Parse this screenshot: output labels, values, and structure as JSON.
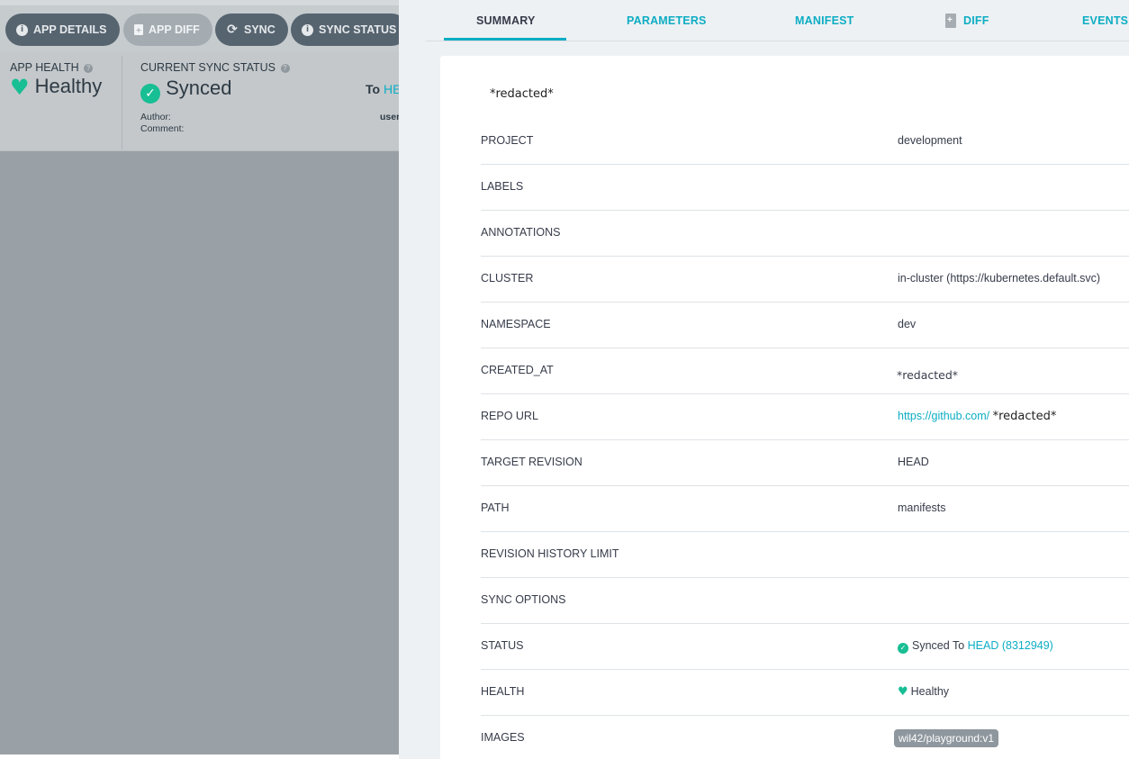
{
  "toolbar": {
    "app_details": "APP DETAILS",
    "app_diff": "APP DIFF",
    "sync": "SYNC",
    "sync_status": "SYNC STATUS"
  },
  "status": {
    "app_health_label": "APP HEALTH",
    "app_health_value": "Healthy",
    "sync_status_label": "CURRENT SYNC STATUS",
    "sync_status_value": "Synced",
    "to_prefix": "To",
    "to_revision": "HE",
    "author_label": "Author:",
    "comment_label": "Comment:",
    "author_value": "user"
  },
  "tabs": {
    "summary": "SUMMARY",
    "parameters": "PARAMETERS",
    "manifest": "MANIFEST",
    "diff": "DIFF",
    "events": "EVENTS"
  },
  "summary": {
    "title": "*redacted*",
    "project_label": "PROJECT",
    "project_value": "development",
    "labels_label": "LABELS",
    "annotations_label": "ANNOTATIONS",
    "cluster_label": "CLUSTER",
    "cluster_value": "in-cluster (https://kubernetes.default.svc)",
    "namespace_label": "NAMESPACE",
    "namespace_value": "dev",
    "created_at_label": "CREATED_AT",
    "created_at_value": "*redacted*",
    "repo_url_label": "REPO URL",
    "repo_url_link": "https://github.com/",
    "repo_url_redacted": "*redacted*",
    "target_revision_label": "TARGET REVISION",
    "target_revision_value": "HEAD",
    "path_label": "PATH",
    "path_value": "manifests",
    "revision_history_label": "REVISION HISTORY LIMIT",
    "sync_options_label": "SYNC OPTIONS",
    "status_label": "STATUS",
    "status_text": "Synced To",
    "status_revision": "HEAD (8312949)",
    "health_label": "HEALTH",
    "health_value": "Healthy",
    "images_label": "IMAGES",
    "images_value": "wil42/playground:v1"
  },
  "colors": {
    "accent": "#0dadc3",
    "healthy": "#18be94",
    "overlay": "#9aa1a6",
    "panel_bg": "#eef1f4"
  },
  "icons": [
    "info-icon",
    "file-diff-icon",
    "sync-icon",
    "help-icon",
    "heart-icon",
    "check-circle-icon"
  ]
}
